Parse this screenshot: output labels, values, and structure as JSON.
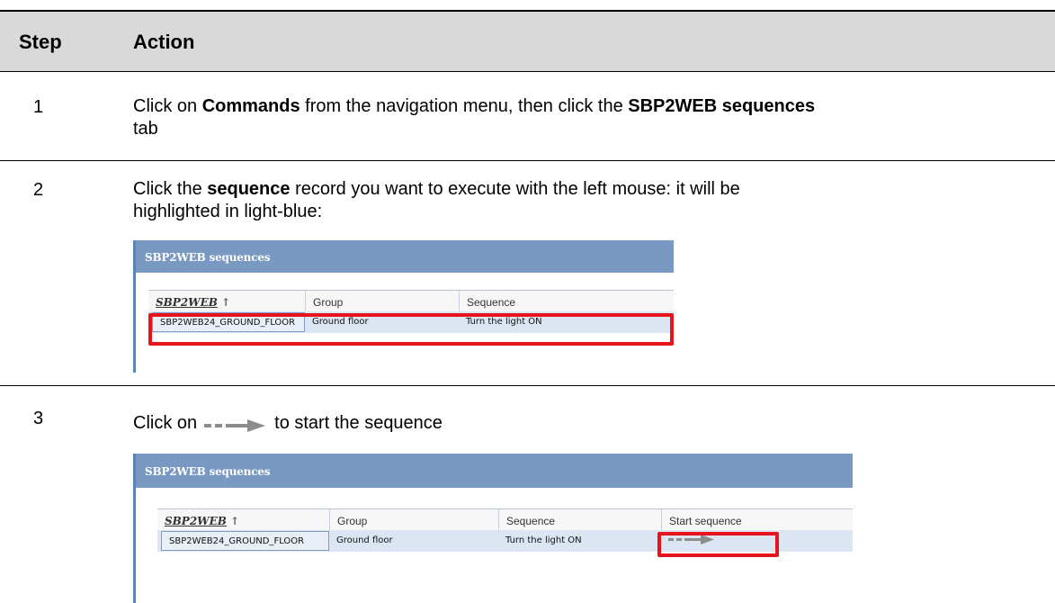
{
  "header": {
    "step": "Step",
    "action": "Action"
  },
  "rows": [
    {
      "num": "1",
      "text": {
        "p1": "Click on ",
        "b1": "Commands",
        "p2": " from the navigation menu, then click the ",
        "b2": "SBP2WEB sequences",
        "p3": " tab"
      }
    },
    {
      "num": "2",
      "text": {
        "p1": "Click the ",
        "b1": "sequence",
        "p2": " record you want to execute with the left mouse:  it will be highlighted in light-blue:"
      }
    },
    {
      "num": "3",
      "text": {
        "p1": "Click on",
        "p2": "to start the sequence"
      }
    }
  ],
  "screens": {
    "title": "SBP2WEB sequences",
    "columns": [
      "SBP2WEB",
      "Group",
      "Sequence",
      "Start sequence"
    ],
    "sort_arrow": "↑",
    "record": {
      "sbp2web": "SBP2WEB24_GROUND_FLOOR",
      "group": "Ground floor",
      "sequence": "Turn the light ON"
    }
  },
  "colors": {
    "title_bar": "#7999c2",
    "highlight": "#dce6f2",
    "red_box": "#e8141c",
    "arrow": "#8c8c8c"
  },
  "icons": {
    "start": "start-sequence-arrow-icon"
  }
}
